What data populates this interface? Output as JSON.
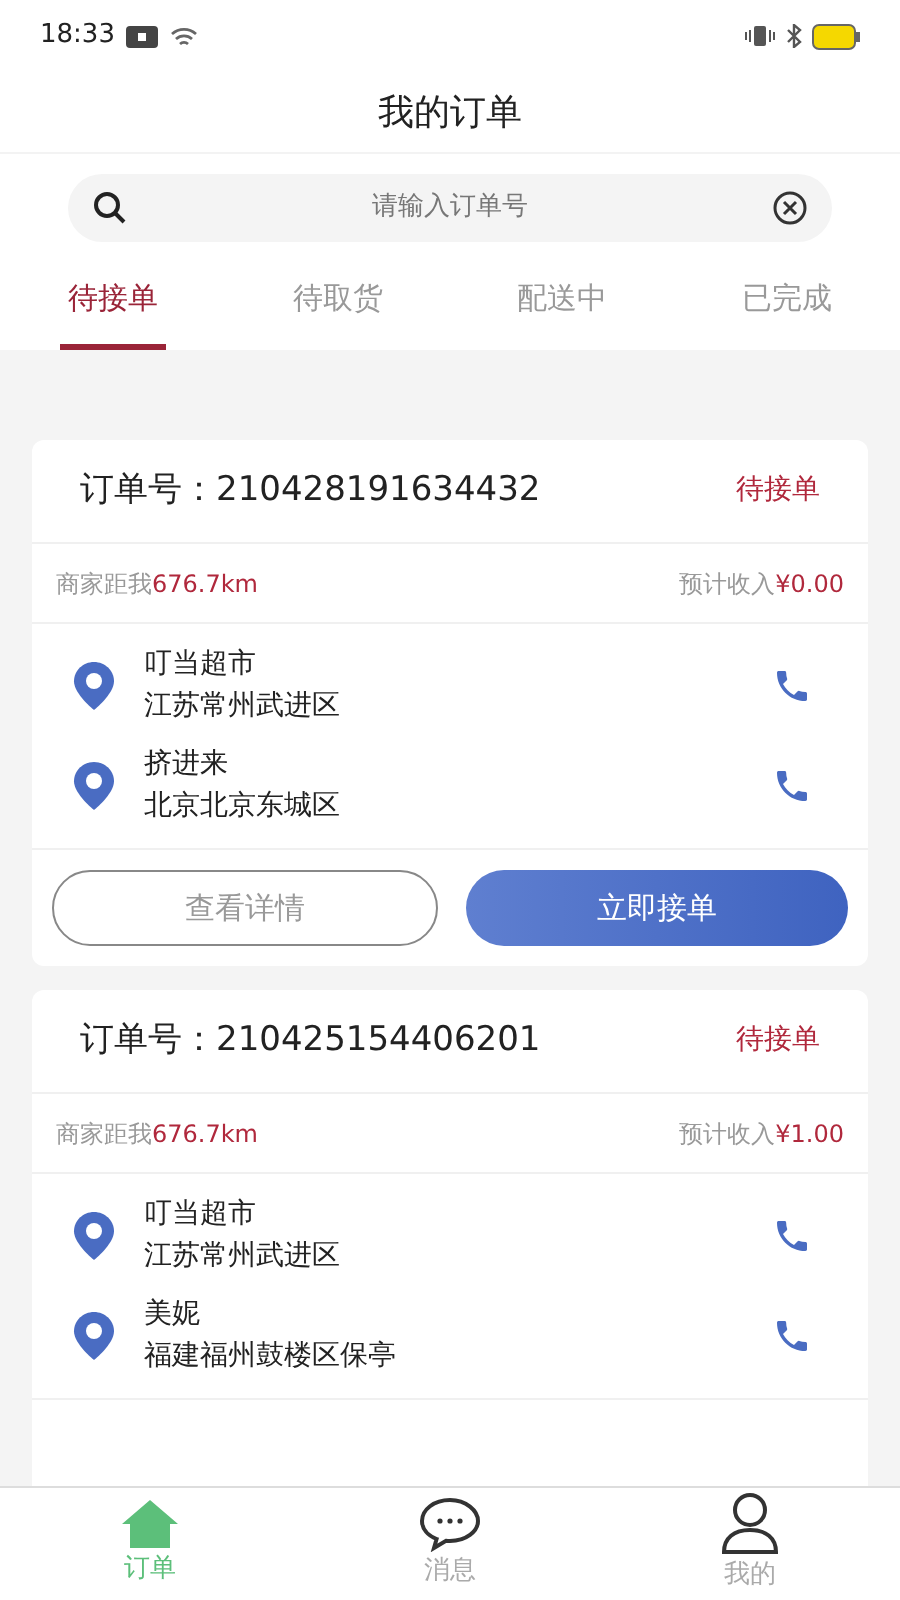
{
  "status_bar": {
    "time": "18:33"
  },
  "title": "我的订单",
  "search": {
    "placeholder": "请输入订单号"
  },
  "tabs": [
    {
      "label": "待接单",
      "selected": true
    },
    {
      "label": "待取货",
      "selected": false
    },
    {
      "label": "配送中",
      "selected": false
    },
    {
      "label": "已完成",
      "selected": false
    }
  ],
  "orders": [
    {
      "order_no": "订单号：210428191634432",
      "status": "待接单",
      "distance": "商家距我**676.7km**",
      "income": "预计收入**¥0.00**",
      "stops": [
        {
          "name": "叮当超市",
          "address": "江苏常州武进区"
        },
        {
          "name": "挤进来",
          "address": "北京北京东城区"
        }
      ],
      "buttons": [
        {
          "label": "查看详情",
          "kind": "outline"
        },
        {
          "label": "立即接单",
          "kind": "primary"
        }
      ]
    },
    {
      "order_no": "订单号：210425154406201",
      "status": "待接单",
      "distance": "商家距我**676.7km**",
      "income": "预计收入**¥1.00**",
      "stops": [
        {
          "name": "叮当超市",
          "address": "江苏常州武进区"
        },
        {
          "name": "美妮",
          "address": "福建福州鼓楼区保亭"
        }
      ]
    }
  ],
  "bottom_nav": [
    {
      "label": "订单",
      "kind": "home",
      "selected": true
    },
    {
      "label": "消息",
      "kind": "chat",
      "selected": false
    },
    {
      "label": "我的",
      "kind": "user",
      "selected": false
    }
  ]
}
